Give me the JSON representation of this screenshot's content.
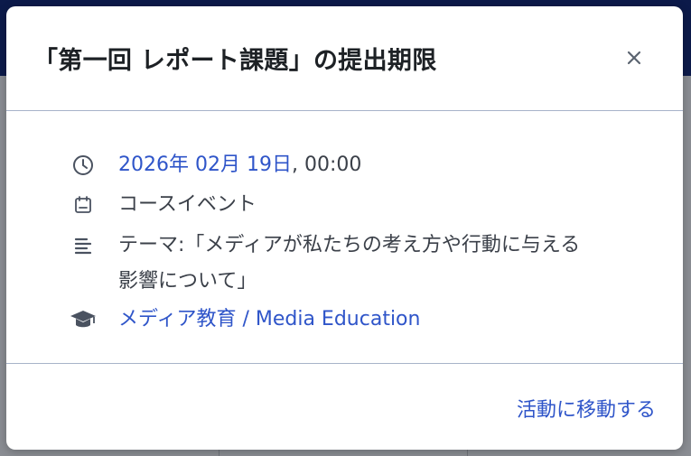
{
  "modal": {
    "title": "「第一回 レポート課題」の提出期限",
    "close_label": "×"
  },
  "event": {
    "date_link": "2026年 02月 19日",
    "time": ", 00:00",
    "event_type": "コースイベント",
    "description_line1": "テーマ:「メディアが私たちの考え方や行動に与える",
    "description_line2": "影響について」",
    "course_link": "メディア教育 / Media Education"
  },
  "footer": {
    "go_to_activity": "活動に移動する"
  },
  "icons": {
    "time": "clock-icon",
    "type": "calendar-icon",
    "description": "description-lines-icon",
    "course": "graduation-cap-icon",
    "close": "close-icon"
  },
  "colors": {
    "link": "#2f55c9",
    "text": "#3b4049",
    "title": "#1d2125",
    "divider": "#a7b3c9",
    "backdrop_top": "#0c1a4a"
  }
}
